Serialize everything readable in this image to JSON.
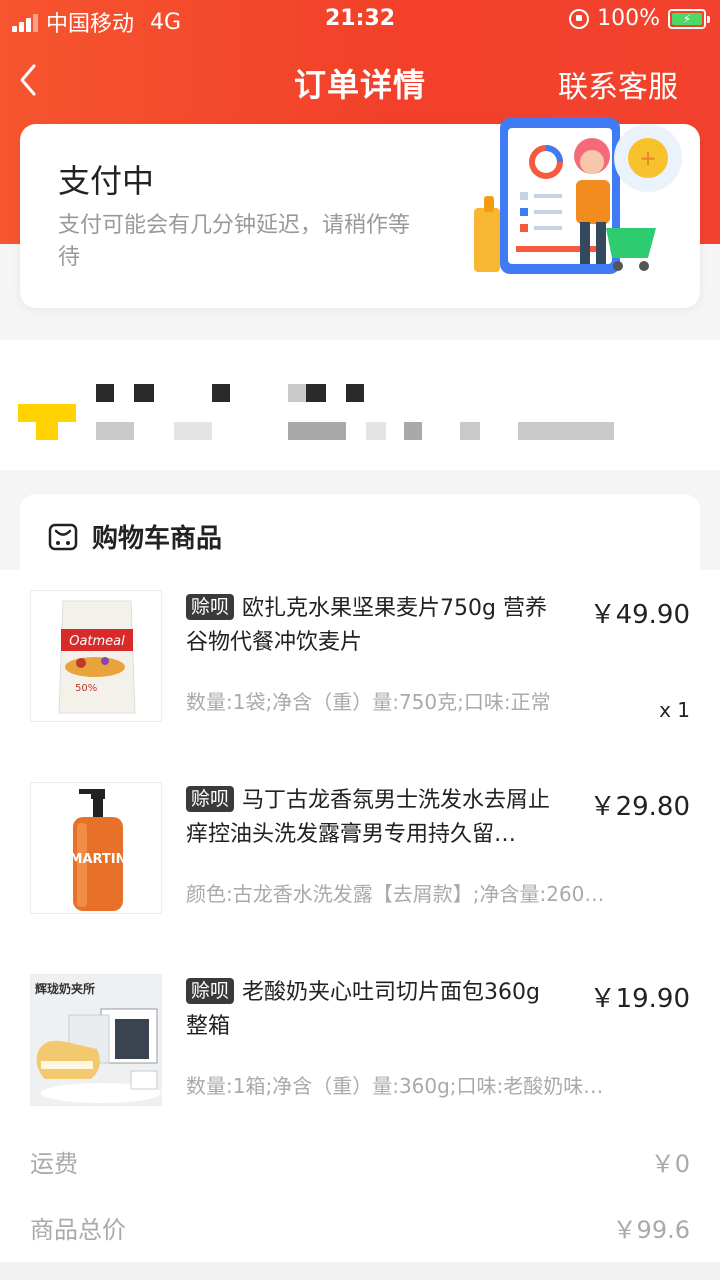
{
  "status_bar": {
    "carrier": "中国移动",
    "network": "4G",
    "time": "21:32",
    "battery": "100%"
  },
  "nav": {
    "title": "订单详情",
    "service": "联系客服"
  },
  "payment": {
    "status": "支付中",
    "desc": "支付可能会有几分钟延迟，请稍作等待"
  },
  "cart": {
    "title": "购物车商品",
    "items": [
      {
        "tag": "赊呗",
        "name": "欧扎克水果坚果麦片750g 营养谷物代餐冲饮麦片",
        "price": "￥49.90",
        "spec": "数量:1袋;净含（重）量:750克;口味:正常",
        "qty": "x 1"
      },
      {
        "tag": "赊呗",
        "name": "马丁古龙香氛男士洗发水去屑止痒控油头洗发露膏男专用持久留…",
        "price": "￥29.80",
        "spec": "颜色:古龙香水洗发露【去屑款】;净含量:260…"
      },
      {
        "tag": "赊呗",
        "name": "老酸奶夹心吐司切片面包360g 整箱",
        "price": "￥19.90",
        "spec": "数量:1箱;净含（重）量:360g;口味:老酸奶味…"
      }
    ],
    "product_labels": {
      "oatmeal": "Oatmeal",
      "oatmeal_badge": "50%",
      "shampoo": "MARTIN",
      "bread_brand": "辉珑奶夹所"
    }
  },
  "fees": {
    "shipping_label": "运费",
    "shipping_value": "￥0",
    "total_label": "商品总价",
    "total_value": "￥99.6"
  },
  "colors": {
    "brand": "#f2432c",
    "tag_bg": "#3a3a3a"
  },
  "icons": {
    "back": "chevron-left-icon",
    "cart": "cart-icon",
    "location": "location-icon"
  }
}
